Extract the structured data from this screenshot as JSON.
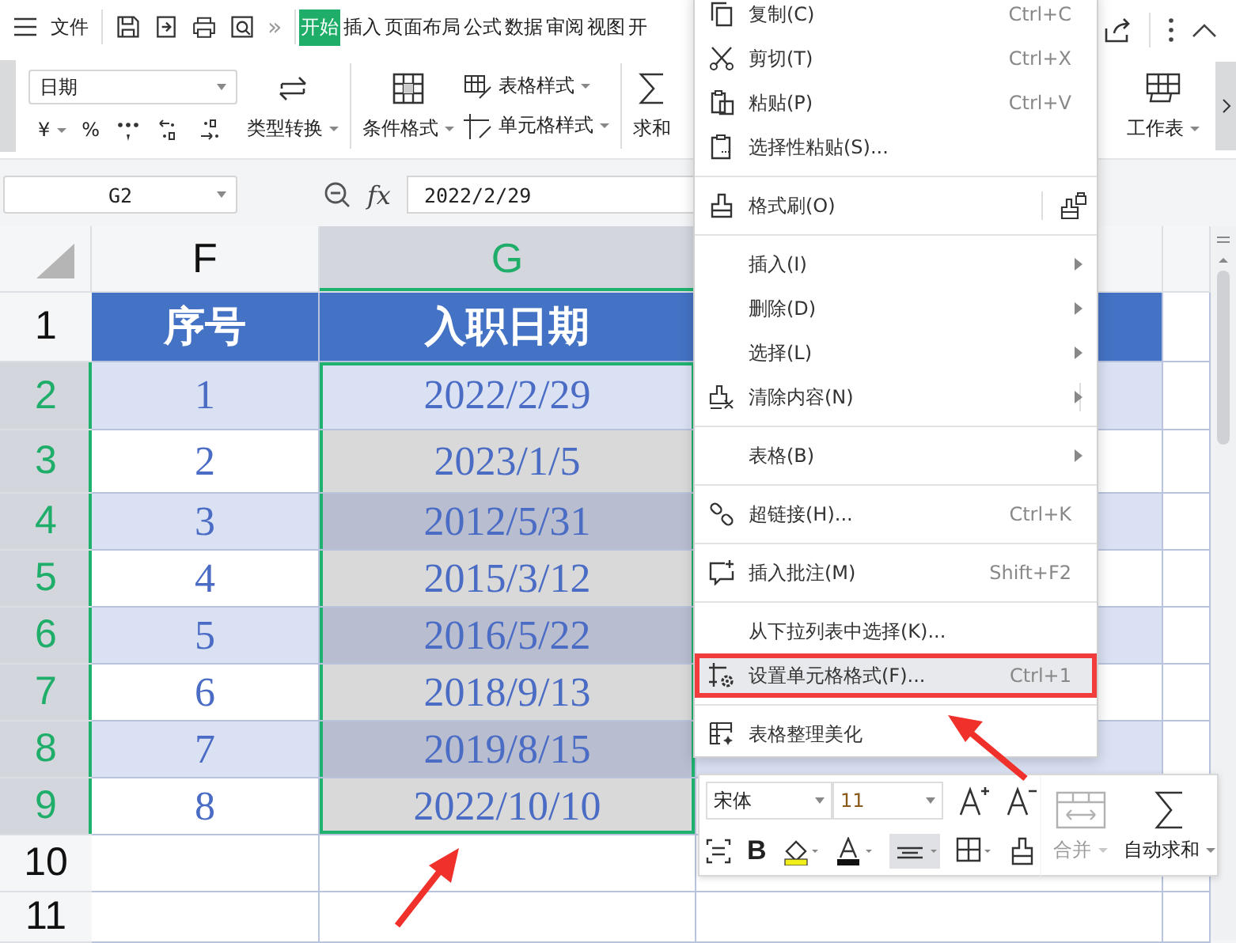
{
  "toolbar": {
    "file_label": "文件",
    "more": "»",
    "tabs": [
      {
        "label": "开始",
        "selected": true
      },
      {
        "label": "插入",
        "selected": false
      },
      {
        "label": "页面布局",
        "selected": false
      },
      {
        "label": "公式",
        "selected": false
      },
      {
        "label": "数据",
        "selected": false
      },
      {
        "label": "审阅",
        "selected": false
      },
      {
        "label": "视图",
        "selected": false
      },
      {
        "label": "开",
        "selected": false
      }
    ]
  },
  "ribbon": {
    "number_format": "日期",
    "currency": "¥",
    "percent": "%",
    "type_convert": "类型转换",
    "conditional_format": "条件格式",
    "table_style": "表格样式",
    "cell_style": "单元格样式",
    "sum": "求和",
    "worksheet": "工作表"
  },
  "formula_bar": {
    "name_box": "G2",
    "fx": "fx",
    "value": "2022/2/29"
  },
  "sheet": {
    "columns": [
      {
        "label": "F",
        "selected": false
      },
      {
        "label": "G",
        "selected": true
      }
    ],
    "rows": [
      {
        "label": "1",
        "kind": "header",
        "selected": false,
        "cells": [
          "序号",
          "入职日期"
        ]
      },
      {
        "label": "2",
        "kind": "data",
        "selected": true,
        "cells": [
          "1",
          "2022/2/29"
        ]
      },
      {
        "label": "3",
        "kind": "data",
        "selected": true,
        "cells": [
          "2",
          "2023/1/5"
        ]
      },
      {
        "label": "4",
        "kind": "data",
        "selected": true,
        "cells": [
          "3",
          "2012/5/31"
        ]
      },
      {
        "label": "5",
        "kind": "data",
        "selected": true,
        "cells": [
          "4",
          "2015/3/12"
        ]
      },
      {
        "label": "6",
        "kind": "data",
        "selected": true,
        "cells": [
          "5",
          "2016/5/22"
        ]
      },
      {
        "label": "7",
        "kind": "data",
        "selected": true,
        "cells": [
          "6",
          "2018/9/13"
        ]
      },
      {
        "label": "8",
        "kind": "data",
        "selected": true,
        "cells": [
          "7",
          "2019/8/15"
        ]
      },
      {
        "label": "9",
        "kind": "data",
        "selected": true,
        "cells": [
          "8",
          "2022/10/10"
        ]
      },
      {
        "label": "10",
        "kind": "empty",
        "selected": false,
        "cells": []
      },
      {
        "label": "11",
        "kind": "empty",
        "selected": false,
        "cells": []
      }
    ]
  },
  "context_menu": [
    {
      "kind": "item",
      "label": "复制(C)",
      "shortcut": "Ctrl+C",
      "submenu": false,
      "selected": false
    },
    {
      "kind": "item",
      "label": "剪切(T)",
      "shortcut": "Ctrl+X",
      "submenu": false,
      "selected": false
    },
    {
      "kind": "item",
      "label": "粘贴(P)",
      "shortcut": "Ctrl+V",
      "submenu": false,
      "selected": false
    },
    {
      "kind": "item",
      "label": "选择性粘贴(S)...",
      "submenu": false,
      "selected": false
    },
    {
      "kind": "divider"
    },
    {
      "kind": "split",
      "label": "格式刷(O)",
      "submenu": false,
      "selected": false
    },
    {
      "kind": "divider"
    },
    {
      "kind": "item",
      "label": "插入(I)",
      "submenu": true,
      "selected": false
    },
    {
      "kind": "item",
      "label": "删除(D)",
      "submenu": true,
      "selected": false
    },
    {
      "kind": "item",
      "label": "选择(L)",
      "submenu": true,
      "selected": false
    },
    {
      "kind": "split",
      "label": "清除内容(N)",
      "submenu": true,
      "selected": false
    },
    {
      "kind": "divider"
    },
    {
      "kind": "item",
      "label": "表格(B)",
      "submenu": true,
      "selected": false
    },
    {
      "kind": "divider"
    },
    {
      "kind": "item",
      "label": "超链接(H)...",
      "shortcut": "Ctrl+K",
      "submenu": false,
      "selected": false
    },
    {
      "kind": "divider"
    },
    {
      "kind": "item",
      "label": "插入批注(M)",
      "shortcut": "Shift+F2",
      "submenu": false,
      "selected": false
    },
    {
      "kind": "divider"
    },
    {
      "kind": "item",
      "label": "从下拉列表中选择(K)...",
      "submenu": false,
      "selected": false
    },
    {
      "kind": "item",
      "label": "设置单元格格式(F)...",
      "shortcut": "Ctrl+1",
      "submenu": false,
      "selected": true
    },
    {
      "kind": "divider"
    },
    {
      "kind": "item",
      "label": "表格整理美化",
      "submenu": false,
      "selected": false
    }
  ],
  "mini_toolbar": {
    "font": "宋体",
    "size": "11",
    "bold": "B",
    "merge_label": "合并",
    "merge_disabled": true,
    "autosum_label": "自动求和",
    "align_active": true
  }
}
